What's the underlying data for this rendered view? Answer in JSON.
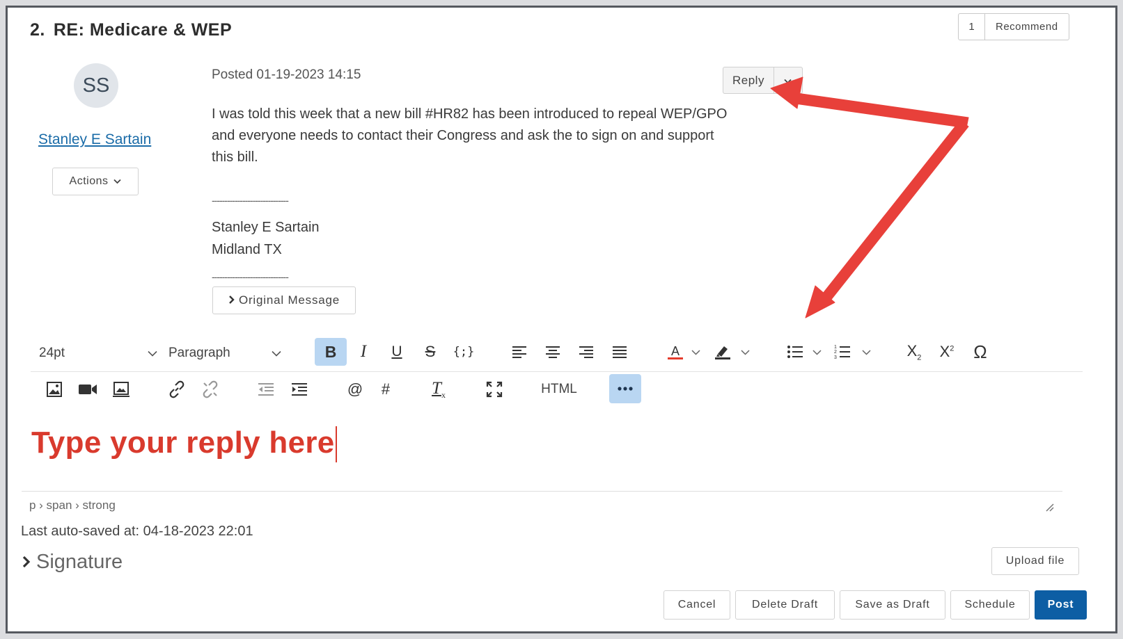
{
  "post": {
    "number": "2.",
    "title": "RE: Medicare & WEP",
    "recommend_count": "1",
    "recommend_label": "Recommend",
    "avatar_initials": "SS",
    "author": "Stanley E Sartain",
    "actions_label": "Actions",
    "posted": "Posted 01-19-2023 14:15",
    "reply_label": "Reply",
    "body_lines": [
      "I was told this week that a new bill #HR82 has been introduced to repeal WEP/GPO",
      "and everyone needs to contact their Congress and ask the to sign on and support",
      "this bill."
    ],
    "signature_rule": "------------------------------",
    "signature_name": "Stanley E Sartain",
    "signature_location": "Midland TX",
    "original_message_label": "Original Message"
  },
  "toolbar": {
    "font_size": "24pt",
    "block_format": "Paragraph",
    "html_label": "HTML"
  },
  "editor": {
    "content": "Type your reply here",
    "element_path": "p › span › strong",
    "autosave": "Last auto-saved at: 04-18-2023 22:01",
    "signature_label": "Signature",
    "upload_label": "Upload file"
  },
  "footer": {
    "cancel": "Cancel",
    "delete_draft": "Delete Draft",
    "save_draft": "Save as Draft",
    "schedule": "Schedule",
    "post": "Post"
  },
  "colors": {
    "annotation_arrow": "#e8403a",
    "editor_text": "#d93a2d",
    "primary_button": "#0d5ea4",
    "link": "#1b6ca8"
  }
}
